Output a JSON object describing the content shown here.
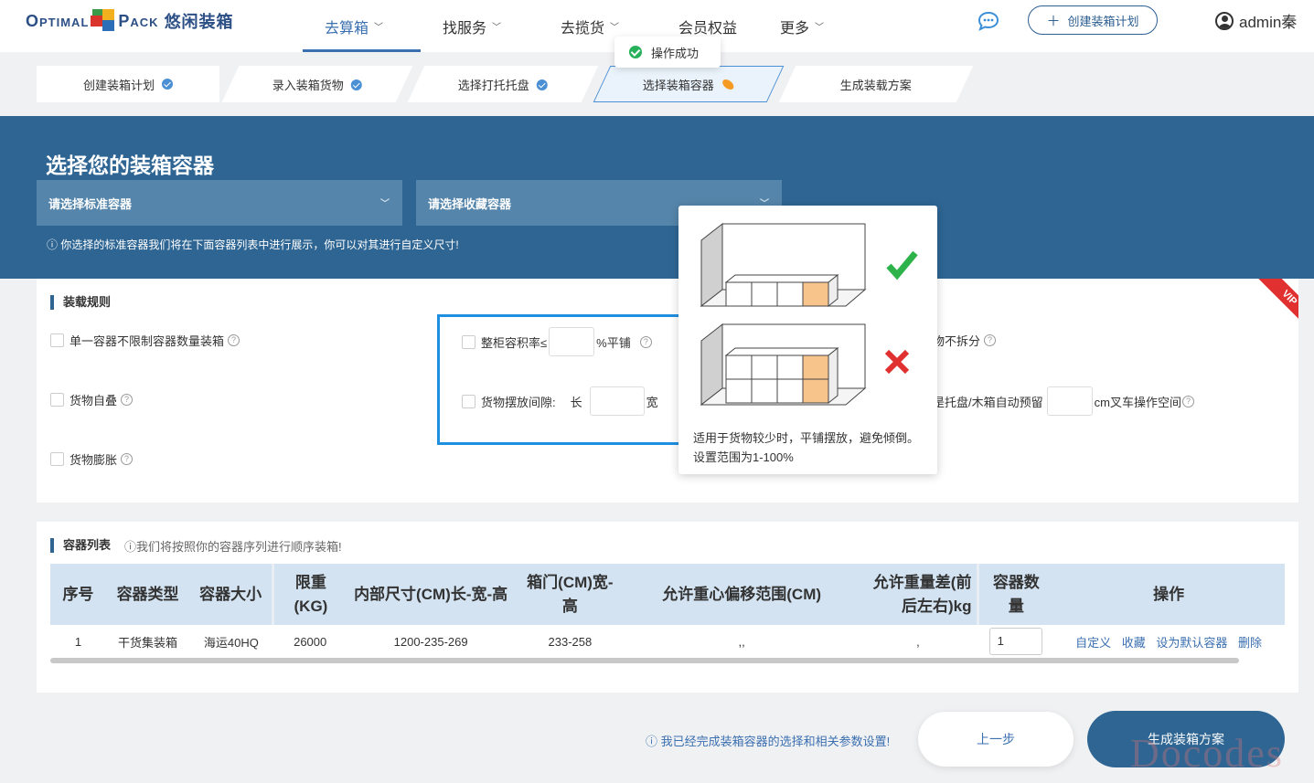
{
  "brand": {
    "logo_text_left": "Optimal",
    "logo_text_right": "Pack",
    "logo_cn": "悠闲装箱"
  },
  "nav": [
    {
      "label": "去算箱"
    },
    {
      "label": "找服务"
    },
    {
      "label": "去揽货"
    },
    {
      "label": "会员权益"
    },
    {
      "label": "更多"
    }
  ],
  "header": {
    "create_plan": "创建装箱计划",
    "username": "admin秦"
  },
  "toast": {
    "message": "操作成功"
  },
  "steps": [
    {
      "label": "创建装箱计划",
      "status": "done"
    },
    {
      "label": "录入装箱货物",
      "status": "done"
    },
    {
      "label": "选择打托托盘",
      "status": "done"
    },
    {
      "label": "选择装箱容器",
      "status": "current"
    },
    {
      "label": "生成装载方案",
      "status": "pending"
    }
  ],
  "banner": {
    "title": "选择您的装箱容器",
    "standard_placeholder": "请选择标准容器",
    "fav_placeholder": "请选择收藏容器",
    "tip": "你选择的标准容器我们将在下面容器列表中进行展示，你可以对其进行自定义尺寸!"
  },
  "rules": {
    "title": "装载规则",
    "vip": "VIP",
    "single_container": "单一容器不限制容器数量装箱",
    "fill_rate_prefix": "整柜容积率≤",
    "fill_rate_suffix": "%平铺",
    "no_split_suffix": "物不拆分",
    "self_stack": "货物自叠",
    "gap_prefix": "货物摆放间隙:",
    "gap_long": "长",
    "gap_wide": "宽",
    "pallet_prefix": "是托盘/木箱自动预留",
    "pallet_suffix": "cm叉车操作空间",
    "expand": "货物膨胀"
  },
  "popover": {
    "desc": "适用于货物较少时，平铺摆放，避免倾倒。设置范围为1-100%"
  },
  "container_list": {
    "title": "容器列表",
    "hint": "我们将按照你的容器序列进行顺序装箱!",
    "columns": [
      "序号",
      "容器类型",
      "容器大小",
      "限重(KG)",
      "内部尺寸(CM)长-宽-高",
      "箱门(CM)宽-高",
      "允许重心偏移范围(CM)",
      "允许重量差(前后左右)kg",
      "容器数量",
      "操作"
    ],
    "rows": [
      {
        "index": "1",
        "type": "干货集装箱",
        "size": "海运40HQ",
        "max_weight": "26000",
        "inner": "1200-235-269",
        "door": "233-258",
        "cog": ",,",
        "weight_diff": ",",
        "qty": "1"
      }
    ],
    "actions": [
      "自定义",
      "收藏",
      "设为默认容器",
      "删除"
    ]
  },
  "footer": {
    "tip": "我已经完成装箱容器的选择和相关参数设置!",
    "prev": "上一步",
    "generate": "生成装箱方案"
  },
  "watermark": "Docodes"
}
